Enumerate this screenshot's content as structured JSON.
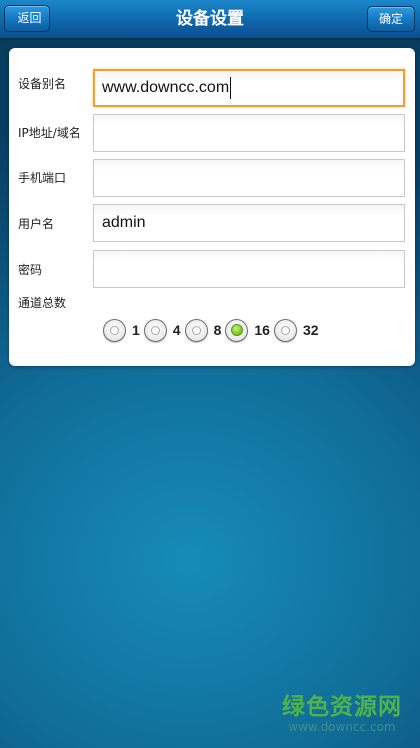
{
  "header": {
    "title": "设备设置",
    "back_label": "返回",
    "confirm_label": "确定"
  },
  "form": {
    "fields": [
      {
        "label": "设备别名",
        "value": "www.downcc.com",
        "focused": true
      },
      {
        "label": "IP地址/域名",
        "value": ""
      },
      {
        "label": "手机端口",
        "value": ""
      },
      {
        "label": "用户名",
        "value": "admin"
      },
      {
        "label": "密码",
        "value": ""
      }
    ],
    "channel_label": "通道总数",
    "channel_options": [
      "1",
      "4",
      "8",
      "16",
      "32"
    ],
    "channel_selected": "16"
  },
  "watermark": {
    "title": "绿色资源网",
    "url": "www.downcc.com"
  },
  "colors": {
    "header": "#0f67ad",
    "focus_border": "#f0a030",
    "radio_selected": "#86cf2a",
    "watermark": "#4fb34a"
  }
}
